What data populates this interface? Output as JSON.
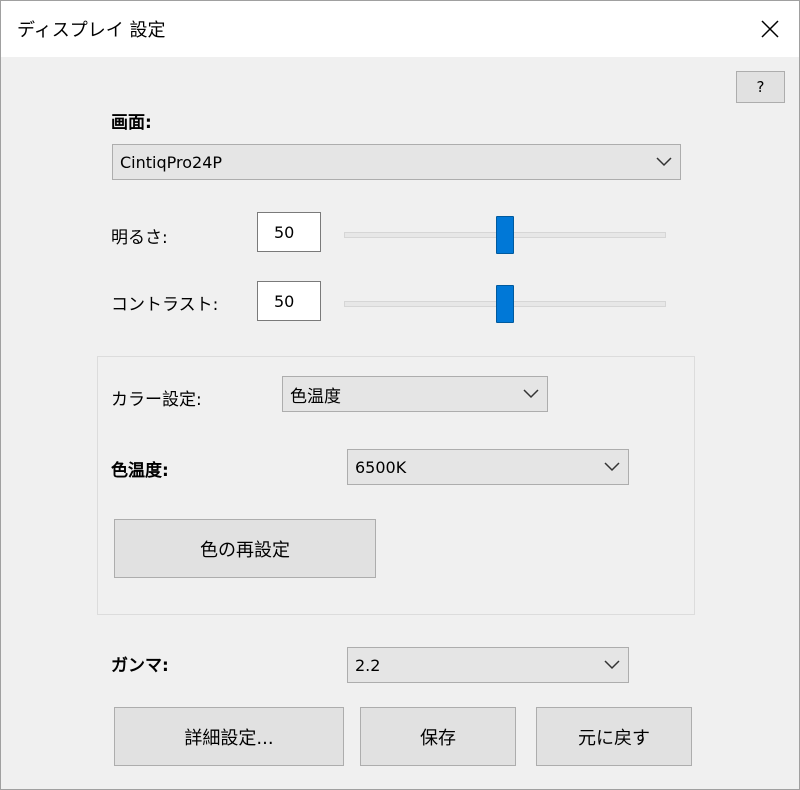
{
  "window": {
    "title": "ディスプレイ 設定"
  },
  "help": {
    "label": "?"
  },
  "screen": {
    "label": "画面:",
    "value": "CintiqPro24P"
  },
  "brightness": {
    "label": "明るさ:",
    "value": "50",
    "level_percent": 50
  },
  "contrast": {
    "label": "コントラスト:",
    "value": "50",
    "level_percent": 50
  },
  "color_settings": {
    "label": "カラー設定:",
    "value": "色温度"
  },
  "color_temp": {
    "label": "色温度:",
    "value": "6500K"
  },
  "reset_color": {
    "label": "色の再設定"
  },
  "gamma": {
    "label": "ガンマ:",
    "value": "2.2"
  },
  "footer": {
    "advanced_label": "詳細設定...",
    "save_label": "保存",
    "revert_label": "元に戻す"
  },
  "colors": {
    "accent": "#0078d7",
    "background": "#f0f0f0",
    "button": "#e1e1e1"
  },
  "icons": {
    "close": "close-icon",
    "dropdown": "chevron-down-icon"
  }
}
